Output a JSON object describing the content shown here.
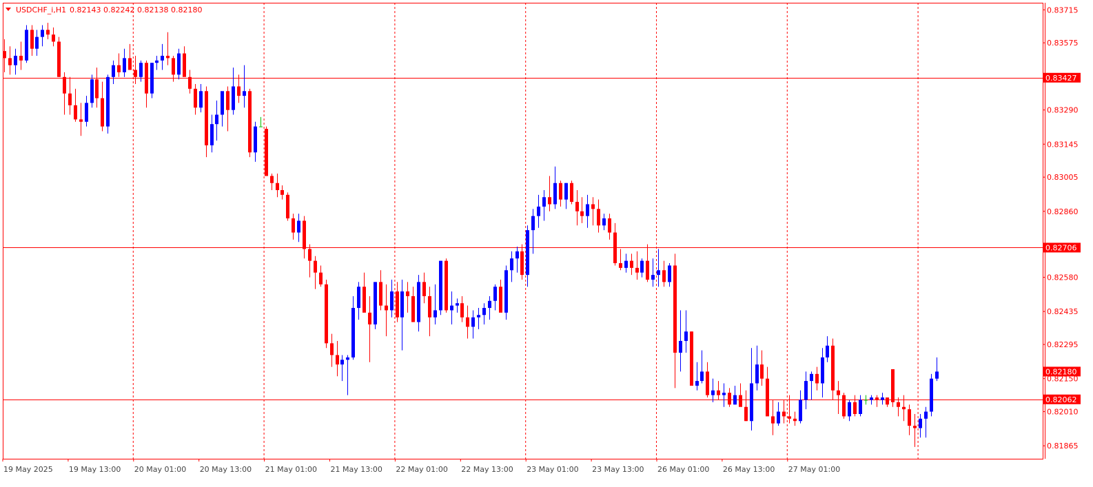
{
  "header": {
    "symbol_text": "USDCHF_i,H1",
    "ohlc_text": "0.82143 0.82242 0.82138 0.82180"
  },
  "colors": {
    "bull": "#0000ff",
    "bear": "#ff0000",
    "doji": "#00c000",
    "frame": "#ff0000",
    "grid": "#ff0000",
    "axis_text": "#ff0000",
    "bottom_text": "#444444",
    "label_bg": "#ff0000",
    "label_text": "#ffffff"
  },
  "chart_data": {
    "type": "candlestick",
    "title": "USDCHF_i,H1",
    "timeframe": "H1",
    "ylim": [
      0.8181,
      0.83745
    ],
    "y_ticks": [
      "0.83715",
      "0.83575",
      "0.83427",
      "0.83290",
      "0.83145",
      "0.83005",
      "0.82860",
      "0.82706",
      "0.82580",
      "0.82435",
      "0.82295",
      "0.82180",
      "0.82150",
      "0.82062",
      "0.82010",
      "0.81865"
    ],
    "x_ticks": [
      "19 May 2025",
      "19 May 13:00",
      "20 May 01:00",
      "20 May 13:00",
      "21 May 01:00",
      "21 May 13:00",
      "22 May 01:00",
      "22 May 13:00",
      "23 May 01:00",
      "23 May 13:00",
      "26 May 01:00",
      "26 May 13:00",
      "27 May 01:00"
    ],
    "period_separators": [
      "20 May 01:00",
      "21 May 01:00",
      "22 May 01:00",
      "23 May 01:00",
      "26 May 01:00",
      "27 May 01:00"
    ],
    "horizontal_lines": [
      "0.83427",
      "0.82706",
      "0.82062"
    ],
    "price_labels": [
      "0.83427",
      "0.82706",
      "0.82180",
      "0.82062"
    ],
    "grid": false,
    "candles": [
      [
        0.8354,
        0.8359,
        0.8345,
        0.8351
      ],
      [
        0.8351,
        0.8356,
        0.8344,
        0.8348
      ],
      [
        0.8348,
        0.8355,
        0.8344,
        0.8352
      ],
      [
        0.8352,
        0.8358,
        0.8346,
        0.835
      ],
      [
        0.835,
        0.8365,
        0.8349,
        0.8363
      ],
      [
        0.8363,
        0.8365,
        0.8352,
        0.8355
      ],
      [
        0.8355,
        0.8363,
        0.8352,
        0.836
      ],
      [
        0.836,
        0.8365,
        0.8356,
        0.8363
      ],
      [
        0.8363,
        0.8366,
        0.8359,
        0.8361
      ],
      [
        0.8361,
        0.8364,
        0.8356,
        0.8358
      ],
      [
        0.8358,
        0.836,
        0.8343,
        0.8343
      ],
      [
        0.8343,
        0.8345,
        0.8327,
        0.8336
      ],
      [
        0.8336,
        0.8343,
        0.8327,
        0.8331
      ],
      [
        0.8331,
        0.8338,
        0.8324,
        0.8325
      ],
      [
        0.8325,
        0.8332,
        0.8318,
        0.8324
      ],
      [
        0.8324,
        0.8335,
        0.8322,
        0.8332
      ],
      [
        0.8332,
        0.8344,
        0.833,
        0.8342
      ],
      [
        0.8342,
        0.8347,
        0.833,
        0.8334
      ],
      [
        0.8334,
        0.8341,
        0.832,
        0.8322
      ],
      [
        0.8322,
        0.8344,
        0.8319,
        0.8343
      ],
      [
        0.8343,
        0.835,
        0.834,
        0.8348
      ],
      [
        0.8348,
        0.8353,
        0.8343,
        0.8345
      ],
      [
        0.8345,
        0.8355,
        0.8343,
        0.8351
      ],
      [
        0.8351,
        0.8357,
        0.8347,
        0.8346
      ],
      [
        0.8346,
        0.8352,
        0.834,
        0.8343
      ],
      [
        0.8343,
        0.835,
        0.8341,
        0.8349
      ],
      [
        0.8349,
        0.835,
        0.833,
        0.8336
      ],
      [
        0.8336,
        0.8349,
        0.8334,
        0.8349
      ],
      [
        0.8349,
        0.8352,
        0.8346,
        0.835
      ],
      [
        0.835,
        0.8357,
        0.8346,
        0.8352
      ],
      [
        0.8352,
        0.8362,
        0.8348,
        0.8351
      ],
      [
        0.8351,
        0.8352,
        0.8341,
        0.8344
      ],
      [
        0.8344,
        0.8355,
        0.8342,
        0.8353
      ],
      [
        0.8353,
        0.8356,
        0.8344,
        0.8343
      ],
      [
        0.8343,
        0.8346,
        0.8336,
        0.8338
      ],
      [
        0.8338,
        0.834,
        0.8327,
        0.833
      ],
      [
        0.833,
        0.834,
        0.8328,
        0.8337
      ],
      [
        0.8337,
        0.8339,
        0.8309,
        0.8314
      ],
      [
        0.8314,
        0.8327,
        0.8311,
        0.8323
      ],
      [
        0.8323,
        0.8333,
        0.8316,
        0.8327
      ],
      [
        0.8327,
        0.8333,
        0.8322,
        0.8337
      ],
      [
        0.8337,
        0.8339,
        0.832,
        0.8329
      ],
      [
        0.8329,
        0.8347,
        0.8327,
        0.8339
      ],
      [
        0.8339,
        0.8344,
        0.8332,
        0.8335
      ],
      [
        0.8335,
        0.8348,
        0.833,
        0.8337
      ],
      [
        0.8337,
        0.8338,
        0.8309,
        0.8311
      ],
      [
        0.8311,
        0.8324,
        0.8307,
        0.8322
      ],
      [
        0.8322,
        0.8326,
        0.8322,
        0.8322
      ],
      [
        0.8321,
        0.8322,
        0.8301,
        0.8301
      ],
      [
        0.8301,
        0.8302,
        0.8295,
        0.8298
      ],
      [
        0.8298,
        0.8302,
        0.8292,
        0.8295
      ],
      [
        0.8295,
        0.8297,
        0.8291,
        0.8293
      ],
      [
        0.8293,
        0.8294,
        0.8282,
        0.8283
      ],
      [
        0.8283,
        0.8285,
        0.8274,
        0.8277
      ],
      [
        0.8277,
        0.8285,
        0.8273,
        0.8282
      ],
      [
        0.8282,
        0.8284,
        0.8266,
        0.827
      ],
      [
        0.827,
        0.8272,
        0.8258,
        0.8265
      ],
      [
        0.8265,
        0.8267,
        0.8253,
        0.826
      ],
      [
        0.826,
        0.8263,
        0.8254,
        0.8255
      ],
      [
        0.8255,
        0.8257,
        0.8228,
        0.823
      ],
      [
        0.823,
        0.8234,
        0.822,
        0.8225
      ],
      [
        0.8225,
        0.8231,
        0.8216,
        0.8221
      ],
      [
        0.8221,
        0.8225,
        0.8214,
        0.8223
      ],
      [
        0.8223,
        0.8225,
        0.8208,
        0.8224
      ],
      [
        0.8224,
        0.825,
        0.8223,
        0.8245
      ],
      [
        0.8245,
        0.8256,
        0.824,
        0.8254
      ],
      [
        0.8254,
        0.826,
        0.8244,
        0.8243
      ],
      [
        0.8243,
        0.825,
        0.8222,
        0.8238
      ],
      [
        0.8238,
        0.8256,
        0.8236,
        0.8256
      ],
      [
        0.8256,
        0.8261,
        0.8244,
        0.8246
      ],
      [
        0.8246,
        0.8255,
        0.8233,
        0.8244
      ],
      [
        0.8244,
        0.8257,
        0.8241,
        0.8252
      ],
      [
        0.8252,
        0.8256,
        0.8239,
        0.8241
      ],
      [
        0.8241,
        0.8257,
        0.8227,
        0.8252
      ],
      [
        0.8252,
        0.8256,
        0.8243,
        0.825
      ],
      [
        0.825,
        0.8254,
        0.824,
        0.8239
      ],
      [
        0.8239,
        0.8259,
        0.8235,
        0.8256
      ],
      [
        0.8256,
        0.826,
        0.8247,
        0.825
      ],
      [
        0.825,
        0.8254,
        0.8233,
        0.8241
      ],
      [
        0.8241,
        0.8255,
        0.8238,
        0.8244
      ],
      [
        0.8244,
        0.8265,
        0.8242,
        0.8265
      ],
      [
        0.8265,
        0.8266,
        0.8243,
        0.8244
      ],
      [
        0.8244,
        0.8252,
        0.8238,
        0.8246
      ],
      [
        0.8246,
        0.8249,
        0.8243,
        0.8247
      ],
      [
        0.8247,
        0.825,
        0.8239,
        0.8241
      ],
      [
        0.8241,
        0.8246,
        0.8232,
        0.8237
      ],
      [
        0.8237,
        0.8244,
        0.8232,
        0.8241
      ],
      [
        0.8241,
        0.8245,
        0.8236,
        0.8242
      ],
      [
        0.8242,
        0.8247,
        0.8238,
        0.8245
      ],
      [
        0.8245,
        0.825,
        0.824,
        0.8248
      ],
      [
        0.8248,
        0.8255,
        0.8244,
        0.8254
      ],
      [
        0.8254,
        0.8257,
        0.8244,
        0.8243
      ],
      [
        0.8243,
        0.8263,
        0.824,
        0.8261
      ],
      [
        0.8261,
        0.8269,
        0.8256,
        0.8266
      ],
      [
        0.8266,
        0.8271,
        0.826,
        0.8269
      ],
      [
        0.8269,
        0.8272,
        0.8257,
        0.8259
      ],
      [
        0.8259,
        0.828,
        0.8254,
        0.8278
      ],
      [
        0.8278,
        0.8287,
        0.8268,
        0.8284
      ],
      [
        0.8284,
        0.8293,
        0.8279,
        0.8288
      ],
      [
        0.8288,
        0.8295,
        0.8282,
        0.8292
      ],
      [
        0.8292,
        0.8301,
        0.8286,
        0.8289
      ],
      [
        0.8289,
        0.8305,
        0.8287,
        0.8298
      ],
      [
        0.8298,
        0.8299,
        0.8288,
        0.8291
      ],
      [
        0.8291,
        0.8298,
        0.8287,
        0.8298
      ],
      [
        0.8298,
        0.8299,
        0.8289,
        0.829
      ],
      [
        0.829,
        0.8295,
        0.828,
        0.8286
      ],
      [
        0.8286,
        0.8292,
        0.8281,
        0.8284
      ],
      [
        0.8284,
        0.8293,
        0.8279,
        0.8289
      ],
      [
        0.8289,
        0.8292,
        0.828,
        0.8287
      ],
      [
        0.8287,
        0.8291,
        0.8277,
        0.828
      ],
      [
        0.828,
        0.8285,
        0.8278,
        0.8283
      ],
      [
        0.8283,
        0.8285,
        0.8274,
        0.8277
      ],
      [
        0.8277,
        0.8281,
        0.8263,
        0.8264
      ],
      [
        0.8264,
        0.827,
        0.8261,
        0.8262
      ],
      [
        0.8262,
        0.8268,
        0.826,
        0.8265
      ],
      [
        0.8265,
        0.8268,
        0.8259,
        0.8262
      ],
      [
        0.8262,
        0.8269,
        0.8257,
        0.826
      ],
      [
        0.826,
        0.8266,
        0.8258,
        0.8265
      ],
      [
        0.8265,
        0.8272,
        0.8256,
        0.8257
      ],
      [
        0.8257,
        0.8266,
        0.8254,
        0.8259
      ],
      [
        0.8259,
        0.827,
        0.8254,
        0.8261
      ],
      [
        0.8261,
        0.8265,
        0.8254,
        0.8256
      ],
      [
        0.8256,
        0.8264,
        0.8254,
        0.8263
      ],
      [
        0.8263,
        0.8268,
        0.8211,
        0.8226
      ],
      [
        0.8226,
        0.8244,
        0.8218,
        0.8231
      ],
      [
        0.8231,
        0.8244,
        0.8226,
        0.8235
      ],
      [
        0.8235,
        0.8235,
        0.8213,
        0.8212
      ],
      [
        0.8212,
        0.8222,
        0.821,
        0.8214
      ],
      [
        0.8214,
        0.8227,
        0.8213,
        0.8218
      ],
      [
        0.8218,
        0.8222,
        0.8207,
        0.8208
      ],
      [
        0.8208,
        0.8215,
        0.8205,
        0.821
      ],
      [
        0.821,
        0.8214,
        0.8206,
        0.8208
      ],
      [
        0.8208,
        0.8213,
        0.8203,
        0.8209
      ],
      [
        0.8209,
        0.8211,
        0.8203,
        0.8204
      ],
      [
        0.8204,
        0.8212,
        0.8204,
        0.8208
      ],
      [
        0.8208,
        0.8213,
        0.8205,
        0.8203
      ],
      [
        0.8203,
        0.821,
        0.8197,
        0.8197
      ],
      [
        0.8197,
        0.8228,
        0.8193,
        0.8213
      ],
      [
        0.8213,
        0.8229,
        0.821,
        0.8221
      ],
      [
        0.8221,
        0.8227,
        0.8212,
        0.8215
      ],
      [
        0.8215,
        0.822,
        0.8204,
        0.8199
      ],
      [
        0.8199,
        0.8206,
        0.8191,
        0.8196
      ],
      [
        0.8196,
        0.8205,
        0.8195,
        0.8201
      ],
      [
        0.8201,
        0.8206,
        0.8196,
        0.8199
      ],
      [
        0.8199,
        0.8208,
        0.8196,
        0.8198
      ],
      [
        0.8198,
        0.8201,
        0.8195,
        0.8197
      ],
      [
        0.8197,
        0.821,
        0.8196,
        0.8206
      ],
      [
        0.8206,
        0.8218,
        0.8202,
        0.8214
      ],
      [
        0.8214,
        0.8218,
        0.8206,
        0.8217
      ],
      [
        0.8217,
        0.822,
        0.821,
        0.8213
      ],
      [
        0.8213,
        0.8228,
        0.8207,
        0.8224
      ],
      [
        0.8224,
        0.8233,
        0.8222,
        0.8229
      ],
      [
        0.8229,
        0.8232,
        0.8206,
        0.821
      ],
      [
        0.821,
        0.8214,
        0.82,
        0.8208
      ],
      [
        0.8208,
        0.8209,
        0.8198,
        0.8199
      ],
      [
        0.8199,
        0.8206,
        0.8197,
        0.8205
      ],
      [
        0.8205,
        0.8208,
        0.8199,
        0.82
      ],
      [
        0.82,
        0.8208,
        0.8199,
        0.8206
      ],
      [
        0.8206,
        0.8208,
        0.8204,
        0.8206
      ],
      [
        0.8206,
        0.8208,
        0.8204,
        0.8207
      ],
      [
        0.8207,
        0.8208,
        0.8203,
        0.8206
      ],
      [
        0.8206,
        0.8209,
        0.8204,
        0.8207
      ],
      [
        0.8207,
        0.8207,
        0.8203,
        0.8204
      ],
      [
        0.8219,
        0.8219,
        0.8203,
        0.8205
      ],
      [
        0.8205,
        0.8207,
        0.8199,
        0.8203
      ],
      [
        0.8203,
        0.8208,
        0.8197,
        0.8202
      ],
      [
        0.8202,
        0.8204,
        0.8191,
        0.8195
      ],
      [
        0.8195,
        0.82,
        0.8186,
        0.8194
      ],
      [
        0.8194,
        0.82,
        0.819,
        0.8198
      ],
      [
        0.8198,
        0.8203,
        0.819,
        0.8201
      ],
      [
        0.8201,
        0.8217,
        0.8199,
        0.8215
      ],
      [
        0.8215,
        0.8224,
        0.8214,
        0.8218
      ]
    ]
  }
}
